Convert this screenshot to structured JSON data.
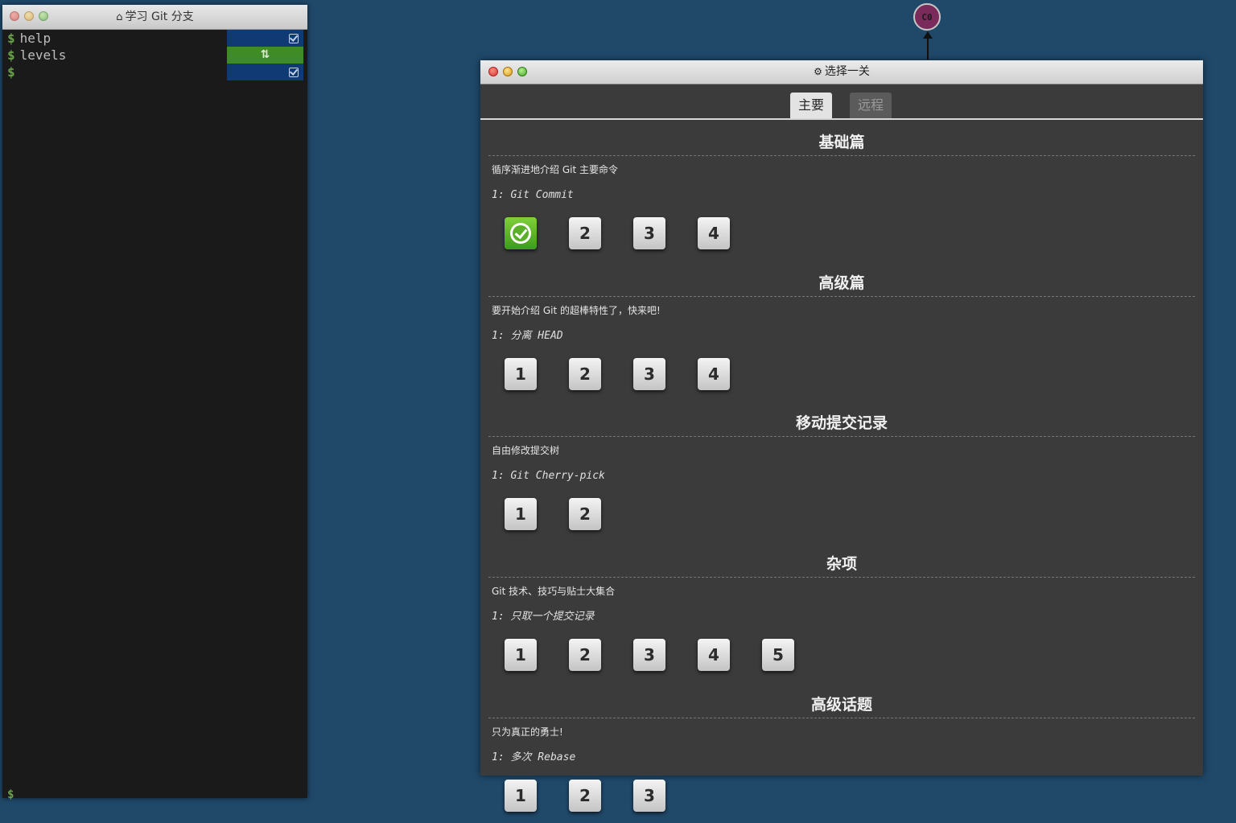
{
  "terminal": {
    "title": "学习 Git 分支",
    "home_icon": "home-icon",
    "prompt_symbol": "$",
    "lines": [
      {
        "command": "help",
        "badge": "check-icon",
        "badge_color": "#103a73"
      },
      {
        "command": "levels",
        "badge": "swap-icon",
        "badge_color": "#3f8b28"
      },
      {
        "command": "",
        "badge": "check-icon",
        "badge_color": "#103a73"
      }
    ],
    "swap_glyph": "⇅"
  },
  "graph": {
    "commit_label": "C0",
    "commit_color": "#7b2a5c"
  },
  "dialog": {
    "title": "选择一关",
    "title_icon": "gear-icon",
    "tabs": [
      {
        "label": "主要",
        "active": true
      },
      {
        "label": "远程",
        "active": false
      }
    ],
    "sections": [
      {
        "title": "基础篇",
        "description": "循序渐进地介绍 Git 主要命令",
        "first_level": "1: Git Commit",
        "levels": [
          {
            "label": "1",
            "completed": true
          },
          {
            "label": "2"
          },
          {
            "label": "3"
          },
          {
            "label": "4"
          }
        ]
      },
      {
        "title": "高级篇",
        "description": "要开始介绍 Git 的超棒特性了，快来吧!",
        "first_level": "1: 分离 HEAD",
        "levels": [
          {
            "label": "1"
          },
          {
            "label": "2"
          },
          {
            "label": "3"
          },
          {
            "label": "4"
          }
        ]
      },
      {
        "title": "移动提交记录",
        "description": "自由修改提交树",
        "first_level": "1: Git Cherry-pick",
        "levels": [
          {
            "label": "1"
          },
          {
            "label": "2"
          }
        ]
      },
      {
        "title": "杂项",
        "description": "Git 技术、技巧与贴士大集合",
        "first_level": "1: 只取一个提交记录",
        "levels": [
          {
            "label": "1"
          },
          {
            "label": "2"
          },
          {
            "label": "3"
          },
          {
            "label": "4"
          },
          {
            "label": "5"
          }
        ]
      },
      {
        "title": "高级话题",
        "description": "只为真正的勇士!",
        "first_level": "1: 多次 Rebase",
        "levels": [
          {
            "label": "1"
          },
          {
            "label": "2"
          },
          {
            "label": "3"
          }
        ]
      }
    ]
  }
}
